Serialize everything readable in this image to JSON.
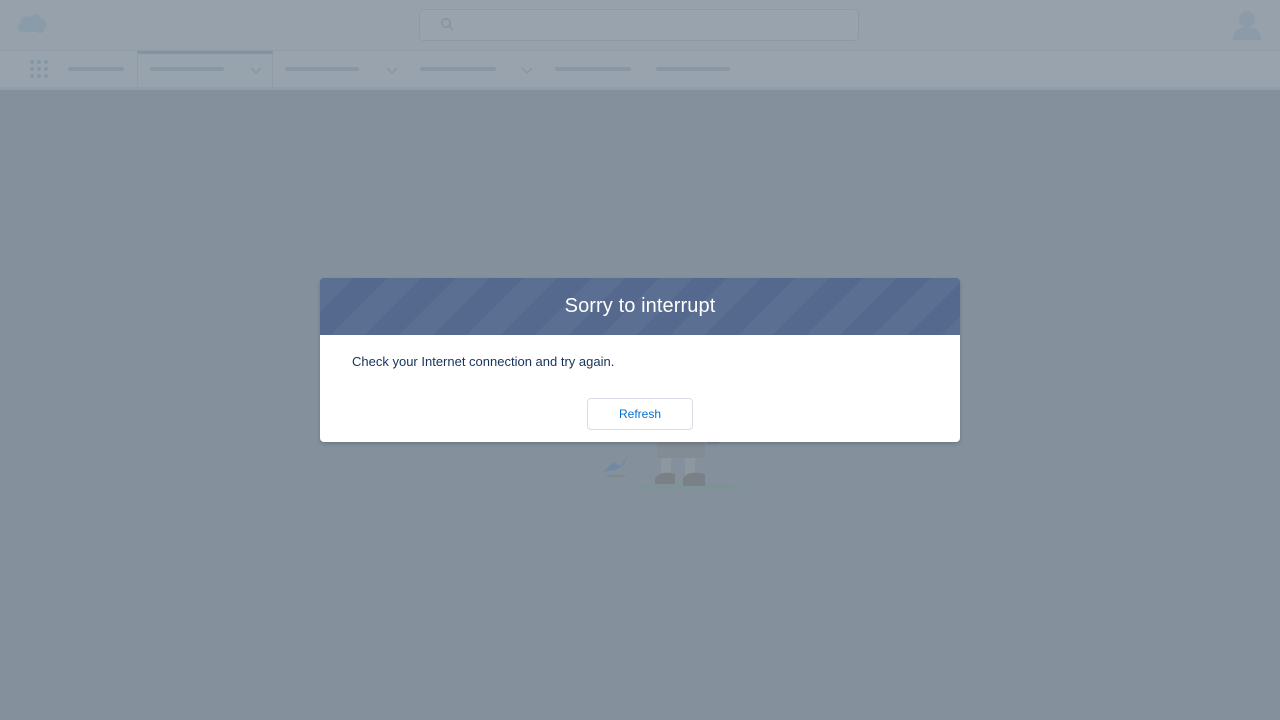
{
  "dialog": {
    "title": "Sorry to interrupt",
    "message": "Check your Internet connection and try again.",
    "refresh_label": "Refresh"
  },
  "colors": {
    "dialog_header": "#54698d",
    "button_text": "#0070d2",
    "backdrop": "#9aa4ae"
  },
  "icons": [
    "cloud-logo-icon",
    "search-icon",
    "user-avatar-icon",
    "app-launcher-icon",
    "chevron-down-icon"
  ]
}
